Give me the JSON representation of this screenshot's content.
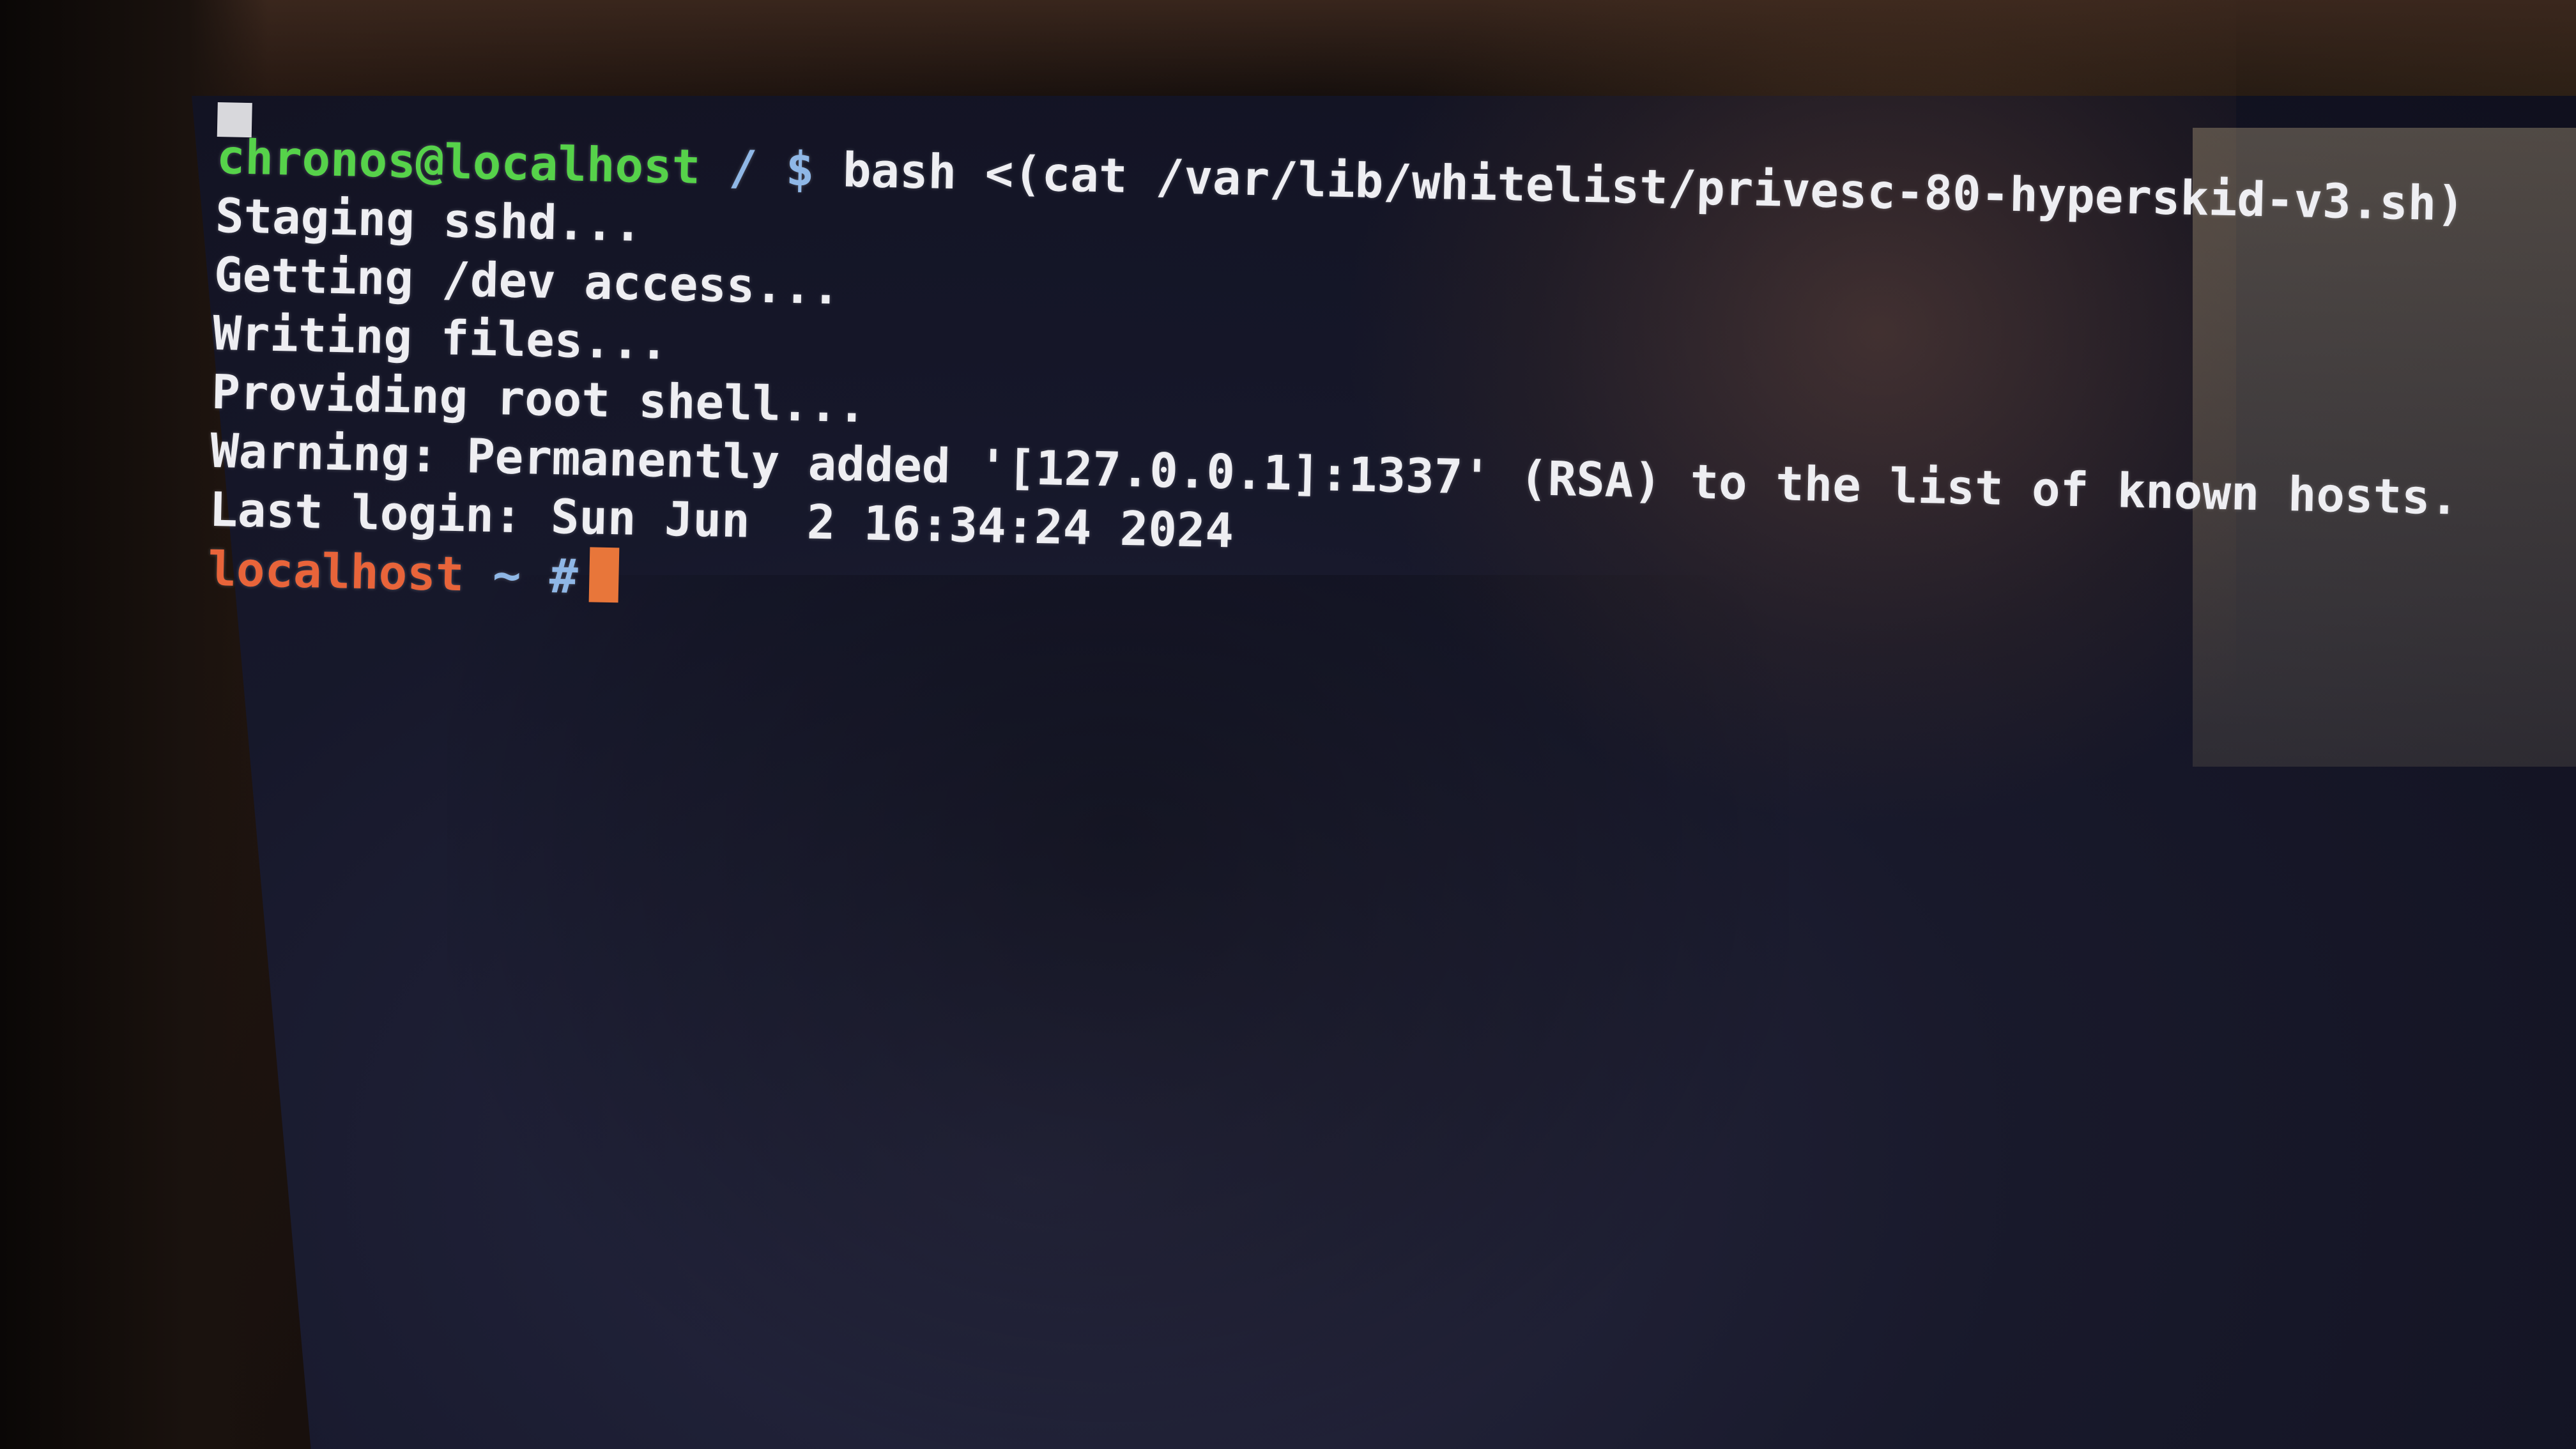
{
  "terminal": {
    "command_line": {
      "user_host": "chronos@localhost",
      "path": "/",
      "prompt_symbol": "$",
      "command": "bash <(cat /var/lib/whitelist/privesc-80-hyperskid-v3.sh)"
    },
    "output": [
      "Staging sshd...",
      "Getting /dev access...",
      "Writing files...",
      "Providing root shell...",
      "Warning: Permanently added '[127.0.0.1]:1337' (RSA) to the list of known hosts.",
      "Last login: Sun Jun  2 16:34:24 2024"
    ],
    "root_prompt": {
      "host": "localhost",
      "path": "~",
      "symbol": "#"
    }
  },
  "colors": {
    "background": "#1c1e34",
    "text": "#eeeef2",
    "user_prompt": "#56d24a",
    "root_prompt": "#e8643a",
    "cursor": "#e8763a"
  }
}
